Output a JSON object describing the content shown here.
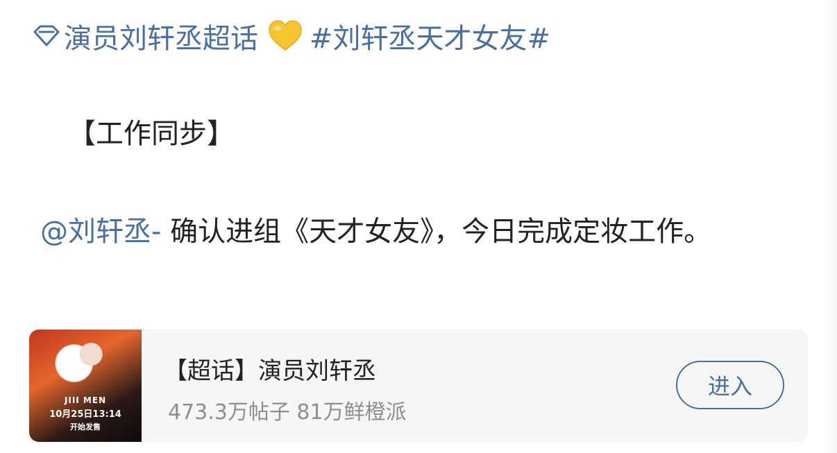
{
  "post": {
    "topic_name": "演员刘轩丞超话",
    "hashtag": "#刘轩丞天才女友#",
    "section_label": "【工作同步】",
    "mention": "@刘轩丞-",
    "body_text": " 确认进组《天才女友》，今日完成定妆工作。"
  },
  "card": {
    "title": "【超话】演员刘轩丞",
    "stats": "473.3万帖子 81万鲜橙派",
    "enter_label": "进入",
    "thumb_brand": "JIII MEN",
    "thumb_date": "10月25日13:14",
    "thumb_sale": "开始发售"
  },
  "colors": {
    "link": "#4a6f9d",
    "text": "#222222",
    "muted": "#8e8e8e",
    "card_bg": "#f6f6f6",
    "heart": "#f7c531"
  },
  "icons": {
    "topic": "diamond-icon",
    "emoji": "yellow-heart-icon"
  }
}
